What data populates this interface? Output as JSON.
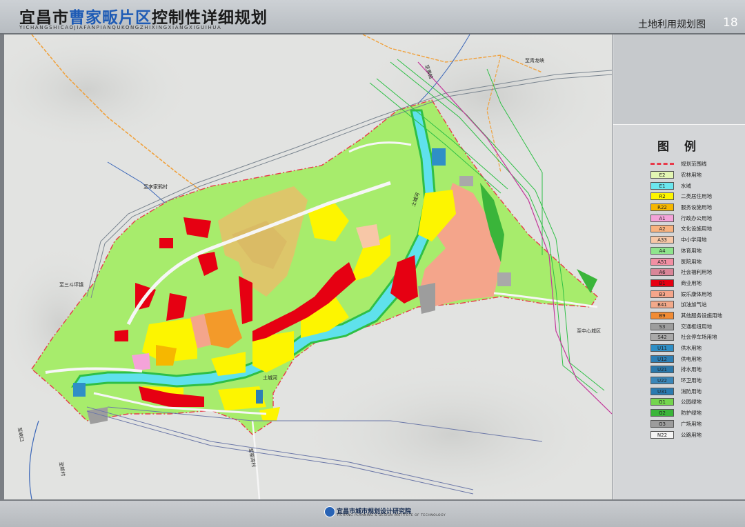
{
  "header": {
    "title_prefix": "宜昌市",
    "title_highlight": "曹家畈片区",
    "title_suffix": "控制性详细规划",
    "pinyin": "YICHANGSHICAOJIAFANPIANQUKONGZHIXINGXIANGXIGUIHUA",
    "sheet_name": "土地利用规划图",
    "page_number": "18"
  },
  "map": {
    "labels": {
      "qinglongxia": "至青龙峡",
      "lixiayuan": "至李家鸦村",
      "sandouping": "至三斗坪镇",
      "zhongxin": "至中心城区",
      "yaoguan": "至窑湾村",
      "huxi": "至峡口",
      "jiangxi": "至新村",
      "north_rd": "至黄柏",
      "river1": "土城河",
      "river2": "土城河"
    },
    "colors": {
      "background": "#e2e3e1",
      "boundary": "#e83a4a",
      "green": "#a7ec6c",
      "yellow": "#fdf500",
      "red": "#e60012",
      "salmon": "#f4a58b",
      "orange": "#f39a2a",
      "water": "#5fe1ec"
    }
  },
  "legend": {
    "title": "图 例",
    "items": [
      {
        "code": "",
        "label": "规划范围线",
        "color": "line"
      },
      {
        "code": "E2",
        "label": "农林用地",
        "color": "#e3f6b3"
      },
      {
        "code": "E1",
        "label": "水域",
        "color": "#6be6ee"
      },
      {
        "code": "R2",
        "label": "二类居住用地",
        "color": "#fdf500"
      },
      {
        "code": "R22",
        "label": "服务设施用地",
        "color": "#f6b700"
      },
      {
        "code": "A1",
        "label": "行政办公用地",
        "color": "#f4a3d9"
      },
      {
        "code": "A2",
        "label": "文化设施用地",
        "color": "#f8b27f"
      },
      {
        "code": "A33",
        "label": "中小学用地",
        "color": "#f7c7a7"
      },
      {
        "code": "A4",
        "label": "体育用地",
        "color": "#8ee58c"
      },
      {
        "code": "A51",
        "label": "医院用地",
        "color": "#f28fa3"
      },
      {
        "code": "A6",
        "label": "社会福利用地",
        "color": "#d98598"
      },
      {
        "code": "B1",
        "label": "商业用地",
        "color": "#e60012"
      },
      {
        "code": "B3",
        "label": "娱乐康体用地",
        "color": "#f5a58a"
      },
      {
        "code": "B41",
        "label": "加油加气站",
        "color": "#f2a98a"
      },
      {
        "code": "B9",
        "label": "其他服务设施用地",
        "color": "#f18b34"
      },
      {
        "code": "S3",
        "label": "交通枢纽用地",
        "color": "#9d9d9d"
      },
      {
        "code": "S42",
        "label": "社会停车场用地",
        "color": "#a9a9a9"
      },
      {
        "code": "U11",
        "label": "供水用地",
        "color": "#2f8fc6"
      },
      {
        "code": "U12",
        "label": "供电用地",
        "color": "#2d7fb5"
      },
      {
        "code": "U21",
        "label": "排水用地",
        "color": "#2b78aa"
      },
      {
        "code": "U22",
        "label": "环卫用地",
        "color": "#3a86b8"
      },
      {
        "code": "U31",
        "label": "消防用地",
        "color": "#2a7ab0"
      },
      {
        "code": "G1",
        "label": "公园绿地",
        "color": "#74d54e"
      },
      {
        "code": "G2",
        "label": "防护绿地",
        "color": "#3ab53a"
      },
      {
        "code": "G3",
        "label": "广场用地",
        "color": "#9c9c9c"
      },
      {
        "code": "N22",
        "label": "公路用地",
        "color": "#f4f4f4"
      }
    ]
  },
  "footer": {
    "institute": "宜昌市城市规划设计研究院",
    "institute_en": "YICHANG PLANNING & DESIGN INSTITUTE OF TECHNOLOGY"
  }
}
